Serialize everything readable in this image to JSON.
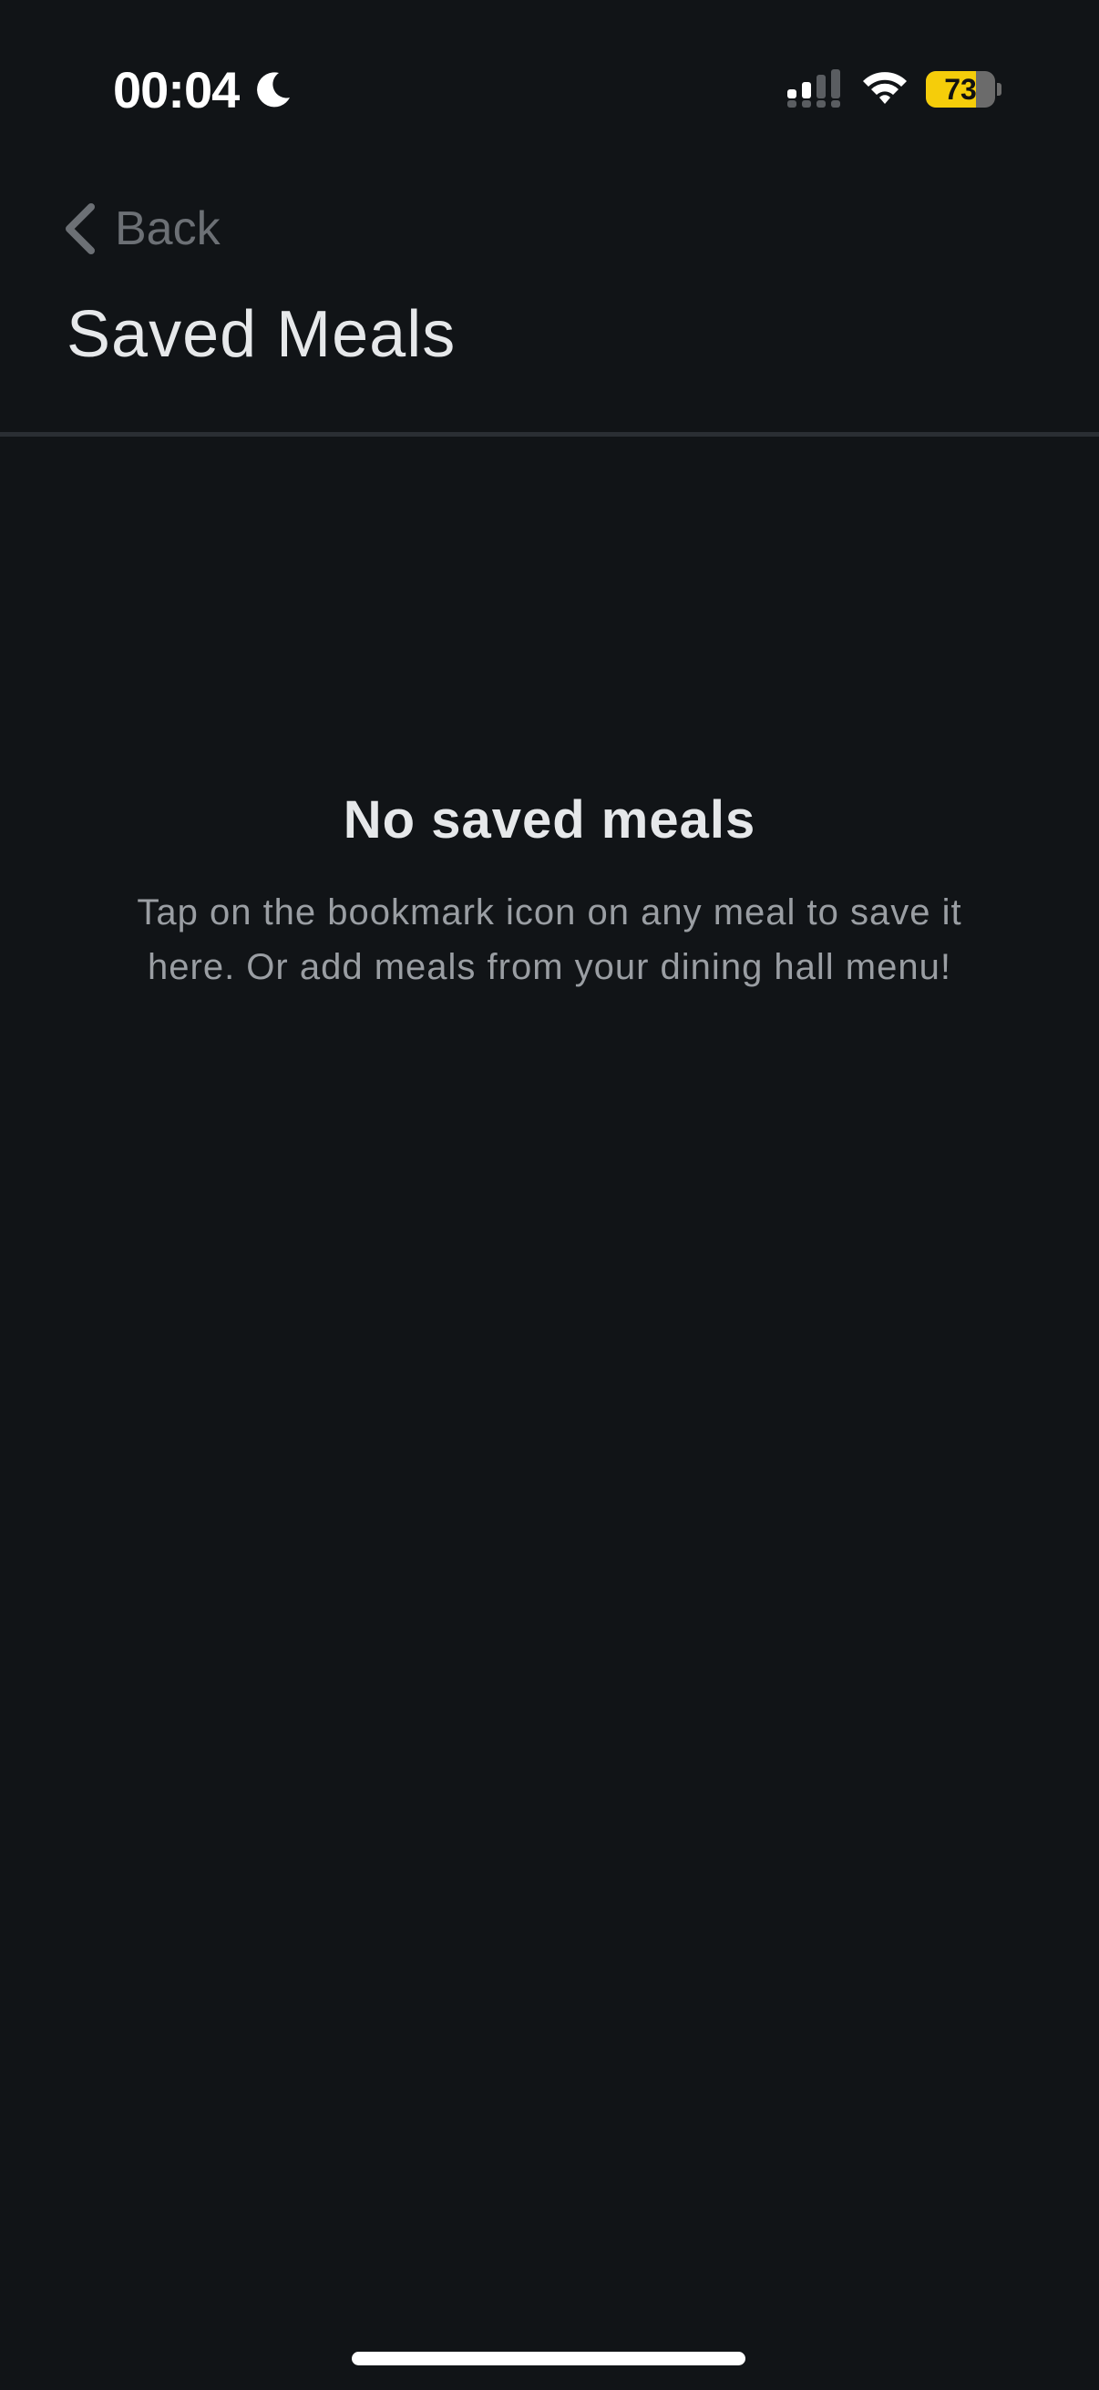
{
  "status_bar": {
    "time": "00:04",
    "focus_icon": "moon-icon",
    "signal_icon": "cellular-signal-icon",
    "wifi_icon": "wifi-icon",
    "battery_level": "73",
    "battery_fraction": 0.73,
    "battery_color": "#f5cd0a"
  },
  "nav": {
    "back_label": "Back",
    "back_icon": "chevron-left-icon",
    "title": "Saved Meals"
  },
  "empty_state": {
    "title": "No saved meals",
    "message": "Tap on the bookmark icon on any meal to save it here. Or add meals from your dining hall menu!"
  },
  "theme": {
    "background": "#111417",
    "primary_text": "#e6e8ea",
    "secondary_text": "#9a9ea3",
    "muted_text": "#6c7075",
    "divider": "#2a2e33"
  }
}
